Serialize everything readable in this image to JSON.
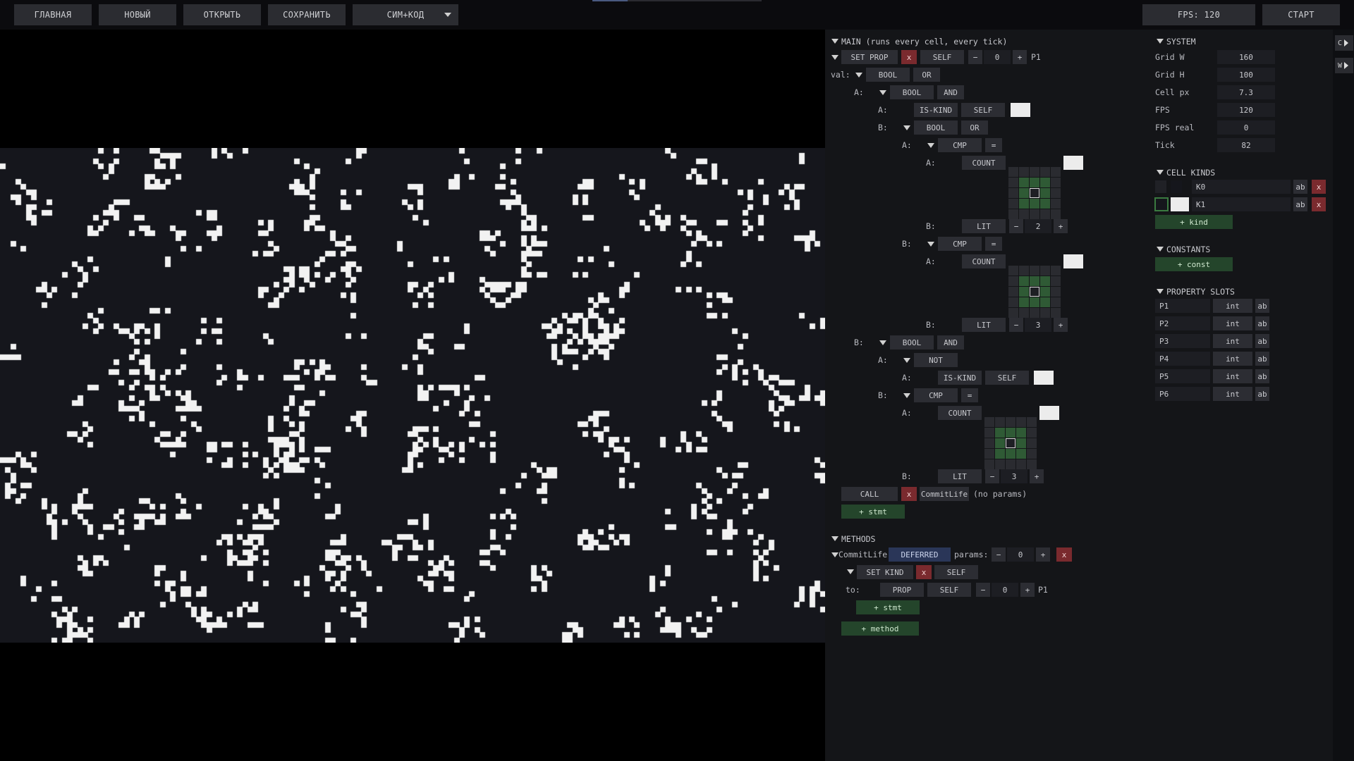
{
  "toolbar": {
    "home": "ГЛАВНАЯ",
    "new": "НОВЫЙ",
    "open": "ОТКРЫТЬ",
    "save": "СОХРАНИТЬ",
    "view_mode": "СИМ+КОД",
    "fps": "FPS: 120",
    "start": "СТАРТ"
  },
  "side_tabs": {
    "c": "C",
    "w": "W"
  },
  "colors": {
    "background": "#000000",
    "sim_bg": "#15161c",
    "cell_alive": "#f2f2f2",
    "panel_bg": "#141518",
    "button": "#2c2d33",
    "danger": "#7a2a2e",
    "add": "#24452b",
    "accent": "#2a3658",
    "neighborhood": "#2f5a35"
  },
  "main": {
    "header": "MAIN (runs every cell, every tick)",
    "set_prop": "SET PROP",
    "x": "x",
    "self": "SELF",
    "minus": "−",
    "plus": "+",
    "prop_index": "0",
    "prop_name": "P1",
    "val_label": "val:",
    "a_label": "A:",
    "b_label": "B:",
    "bool": "BOOL",
    "or": "OR",
    "and": "AND",
    "not": "NOT",
    "is_kind": "IS-KIND",
    "cmp": "CMP",
    "eq": "=",
    "count": "COUNT",
    "lit": "LIT",
    "lit_values": [
      "2",
      "3",
      "3"
    ],
    "call": "CALL",
    "call_target": "CommitLife",
    "no_params": "(no params)",
    "add_stmt": "+ stmt"
  },
  "methods": {
    "header": "METHODS",
    "name": "CommitLife",
    "mode": "DEFERRED",
    "params_label": "params:",
    "params_value": "0",
    "set_kind": "SET KIND",
    "to_label": "to:",
    "prop": "PROP",
    "prop_index": "0",
    "prop_name": "P1",
    "add_stmt": "+ stmt",
    "add_method": "+ method"
  },
  "system": {
    "header": "SYSTEM",
    "rows": [
      {
        "label": "Grid W",
        "value": "160"
      },
      {
        "label": "Grid H",
        "value": "100"
      },
      {
        "label": "Cell px",
        "value": "7.3"
      },
      {
        "label": "FPS",
        "value": "120"
      },
      {
        "label": "FPS real",
        "value": "0"
      },
      {
        "label": "Tick",
        "value": "82"
      }
    ]
  },
  "cell_kinds": {
    "header": "CELL KINDS",
    "items": [
      {
        "name": "K0",
        "ab": "ab",
        "x": "x"
      },
      {
        "name": "K1",
        "ab": "ab",
        "x": "x"
      }
    ],
    "add": "+ kind"
  },
  "constants": {
    "header": "CONSTANTS",
    "add": "+ const"
  },
  "property_slots": {
    "header": "PROPERTY SLOTS",
    "items": [
      {
        "name": "P1",
        "type": "int",
        "ab": "ab"
      },
      {
        "name": "P2",
        "type": "int",
        "ab": "ab"
      },
      {
        "name": "P3",
        "type": "int",
        "ab": "ab"
      },
      {
        "name": "P4",
        "type": "int",
        "ab": "ab"
      },
      {
        "name": "P5",
        "type": "int",
        "ab": "ab"
      },
      {
        "name": "P6",
        "type": "int",
        "ab": "ab"
      }
    ]
  }
}
